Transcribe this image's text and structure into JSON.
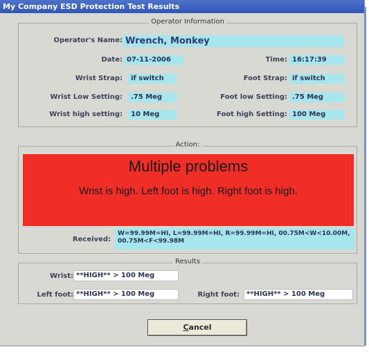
{
  "window": {
    "title": "My Company ESD Protection Test Results"
  },
  "operator": {
    "legend": "Operator Information",
    "name_label": "Operator's Name:",
    "name": "Wrench, Monkey",
    "date_label": "Date:",
    "date": "07-11-2006",
    "time_label": "Time:",
    "time": "16:17:39",
    "wrist_strap_label": "Wrist Strap:",
    "wrist_strap": "if switch",
    "foot_strap_label": "Foot Strap:",
    "foot_strap": "if switch",
    "wrist_low_label": "Wrist Low Setting:",
    "wrist_low": ".75 Meg",
    "foot_low_label": "Foot low Setting:",
    "foot_low": ".75 Meg",
    "wrist_high_label": "Wrist high setting:",
    "wrist_high": "10 Meg",
    "foot_high_label": "Foot high Setting:",
    "foot_high": "100 Meg"
  },
  "action": {
    "legend": "Action:",
    "title": "Multiple problems",
    "message": "Wrist is high. Left foot is high. Right foot is high.",
    "alert_color": "#f02d27",
    "received_label": "Received:",
    "received": "W=99.99M=HI, L=99.99M=HI, R=99.99M=HI, 00.75M<W<10.00M, 00.75M<F<99.98M"
  },
  "results": {
    "legend": "Results",
    "wrist_label": "Wrist:",
    "wrist": "**HIGH** > 100 Meg",
    "left_foot_label": "Left foot:",
    "left_foot": "**HIGH** > 100 Meg",
    "right_foot_label": "Right foot:",
    "right_foot": "**HIGH** > 100 Meg"
  },
  "buttons": {
    "cancel_first": "C",
    "cancel_rest": "ancel"
  }
}
